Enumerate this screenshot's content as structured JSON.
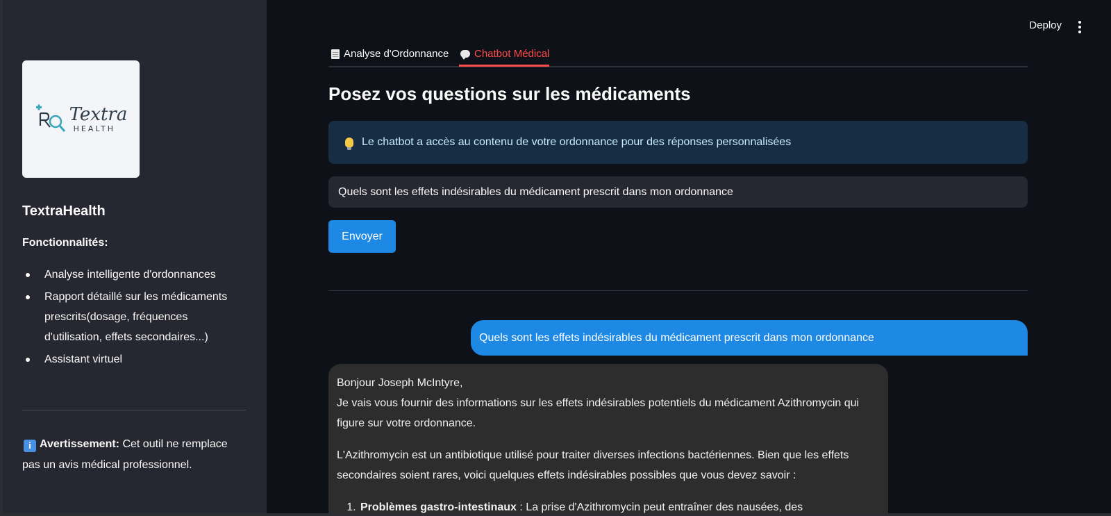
{
  "sidebar": {
    "logo": {
      "word": "Textra",
      "sub": "HEALTH",
      "rx": "Rx"
    },
    "app_name": "TextraHealth",
    "features_title": "Fonctionnalités:",
    "features": [
      "Analyse intelligente d'ordonnances",
      "Rapport détaillé sur les médicaments prescrits(dosage, fréquences d'utilisation, effets secondaires...)",
      "Assistant virtuel"
    ],
    "warning": {
      "icon": "i",
      "label": "Avertissement:",
      "text": " Cet outil ne remplace pas un avis médical professionnel."
    }
  },
  "header": {
    "deploy_label": "Deploy"
  },
  "tabs": [
    {
      "label": "Analyse d'Ordonnance",
      "icon": "document-icon",
      "active": false
    },
    {
      "label": "Chatbot Médical",
      "icon": "chat-bubble-icon",
      "active": true
    }
  ],
  "main": {
    "title": "Posez vos questions sur les médicaments",
    "info": "Le chatbot a accès au contenu de votre ordonnance pour des réponses personnalisées",
    "input_value": "Quels sont les effets indésirables du médicament prescrit dans mon ordonnance",
    "send_label": "Envoyer",
    "user_message": "Quels sont les effets indésirables du médicament prescrit dans mon ordonnance",
    "bot_message": {
      "greeting": "Bonjour Joseph McIntyre,",
      "line1": "Je vais vous fournir des informations sur les effets indésirables potentiels du médicament Azithromycin qui figure sur votre ordonnance.",
      "para2": "L'Azithromycin est un antibiotique utilisé pour traiter diverses infections bactériennes. Bien que les effets secondaires soient rares, voici quelques effets indésirables possibles que vous devez savoir :",
      "item1_title": "Problèmes gastro-intestinaux",
      "item1_text": " : La prise d'Azithromycin peut entraîner des nausées, des"
    }
  },
  "colors": {
    "accent": "#ff4b4b",
    "primary": "#1e88e5",
    "sidebar_bg": "#262730",
    "main_bg": "#0e1117",
    "info_bg": "#172d43"
  }
}
